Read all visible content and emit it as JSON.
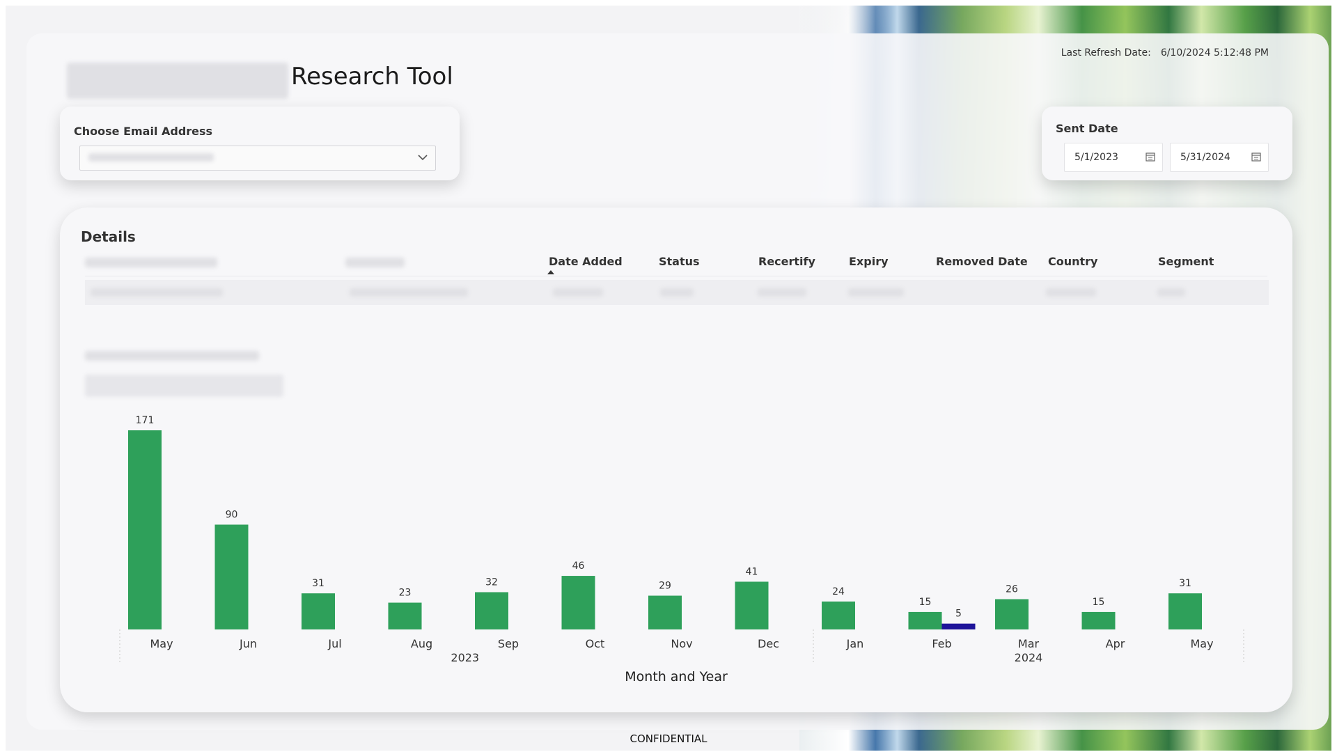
{
  "header": {
    "title": "Research Tool",
    "refresh_label": "Last Refresh Date:",
    "refresh_value": "6/10/2024 5:12:48 PM"
  },
  "email_slicer": {
    "title": "Choose Email Address",
    "placeholder": ""
  },
  "date_slicer": {
    "title": "Sent Date",
    "start": "5/1/2023",
    "end": "5/31/2024"
  },
  "details": {
    "title": "Details",
    "columns": [
      "Date Added",
      "Status",
      "Recertify",
      "Expiry",
      "Removed Date",
      "Country",
      "Segment"
    ]
  },
  "footer": {
    "text": "CONFIDENTIAL"
  },
  "icons": {
    "dropdown": "chevron-down-icon",
    "calendar": "calendar-icon",
    "sort": "sort-ascending-icon"
  },
  "colors": {
    "bar_primary": "#2ea05a",
    "bar_secondary": "#1e149a"
  },
  "chart_data": {
    "type": "bar",
    "xlabel": "Month and Year",
    "ylabel": "",
    "categories": [
      "May",
      "Jun",
      "Jul",
      "Aug",
      "Sep",
      "Oct",
      "Nov",
      "Dec",
      "Jan",
      "Feb",
      "Mar",
      "Apr",
      "May"
    ],
    "years": [
      {
        "label": "2023",
        "from": 0,
        "to": 7
      },
      {
        "label": "2024",
        "from": 8,
        "to": 12
      }
    ],
    "series": [
      {
        "values": [
          171,
          90,
          31,
          23,
          32,
          46,
          29,
          41,
          24,
          15,
          26,
          15,
          31
        ],
        "color": "#2ea05a"
      },
      {
        "values": [
          null,
          null,
          null,
          null,
          null,
          null,
          null,
          null,
          null,
          5,
          null,
          null,
          null
        ],
        "color": "#1e149a"
      }
    ],
    "ylim": [
      0,
      171
    ],
    "grid": false,
    "data_labels": true
  }
}
